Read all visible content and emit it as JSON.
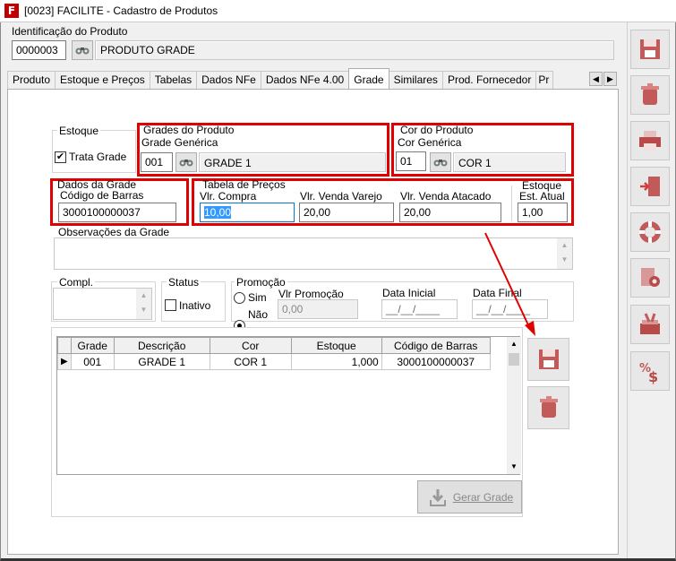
{
  "window": {
    "title": "[0023] FACILITE - Cadastro de Produtos",
    "app_icon_letter": "F"
  },
  "identificacao": {
    "label": "Identificação do Produto",
    "code": "0000003",
    "name": "PRODUTO GRADE"
  },
  "tabs": [
    {
      "label": "Produto"
    },
    {
      "label": "Estoque e Preços"
    },
    {
      "label": "Tabelas"
    },
    {
      "label": "Dados NFe"
    },
    {
      "label": "Dados NFe 4.00"
    },
    {
      "label": "Grade",
      "active": true
    },
    {
      "label": "Similares"
    },
    {
      "label": "Prod. Fornecedor"
    },
    {
      "label": "Pr"
    }
  ],
  "estoque_group": {
    "label": "Estoque",
    "trata_grade_label": "Trata Grade",
    "trata_grade_checked": true
  },
  "grades_produto": {
    "label": "Grades do Produto",
    "sub_label": "Grade Genérica",
    "code": "001",
    "name": "GRADE 1"
  },
  "cor_produto": {
    "label": "Cor do Produto",
    "sub_label": "Cor Genérica",
    "code": "01",
    "name": "COR 1"
  },
  "dados_grade": {
    "label": "Dados da Grade",
    "barcode_label": "Código de Barras",
    "barcode": "3000100000037"
  },
  "tabela_precos": {
    "label": "Tabela de Preços",
    "vlr_compra_label": "Vlr. Compra",
    "vlr_compra": "10,00",
    "vlr_varejo_label": "Vlr. Venda Varejo",
    "vlr_varejo": "20,00",
    "vlr_atacado_label": "Vlr. Venda Atacado",
    "vlr_atacado": "20,00"
  },
  "estoque_atual": {
    "label": "Estoque",
    "sub_label": "Est. Atual",
    "value": "1,00"
  },
  "observacoes": {
    "label": "Observações da Grade",
    "value": ""
  },
  "compl": {
    "label": "Compl.",
    "value": ""
  },
  "status": {
    "label": "Status",
    "inativo_label": "Inativo",
    "inativo_checked": false
  },
  "promocao": {
    "label": "Promoção",
    "sim_label": "Sim",
    "nao_label": "Não",
    "selected": "Não",
    "vlr_label": "Vlr Promoção",
    "vlr_value": "0,00",
    "data_inicial_label": "Data Inicial",
    "data_inicial": "__/__/____",
    "data_final_label": "Data Final",
    "data_final": "__/__/____"
  },
  "grid": {
    "columns": [
      "Grade",
      "Descrição",
      "Cor",
      "Estoque",
      "Código de Barras"
    ],
    "rows": [
      [
        "001",
        "GRADE 1",
        "COR 1",
        "1,000",
        "3000100000037"
      ]
    ]
  },
  "gerar_grade_label": "Gerar Grade",
  "colors": {
    "highlight_red": "#e00000",
    "icon_red": "#b84a4a",
    "selection_blue": "#3399ff"
  }
}
